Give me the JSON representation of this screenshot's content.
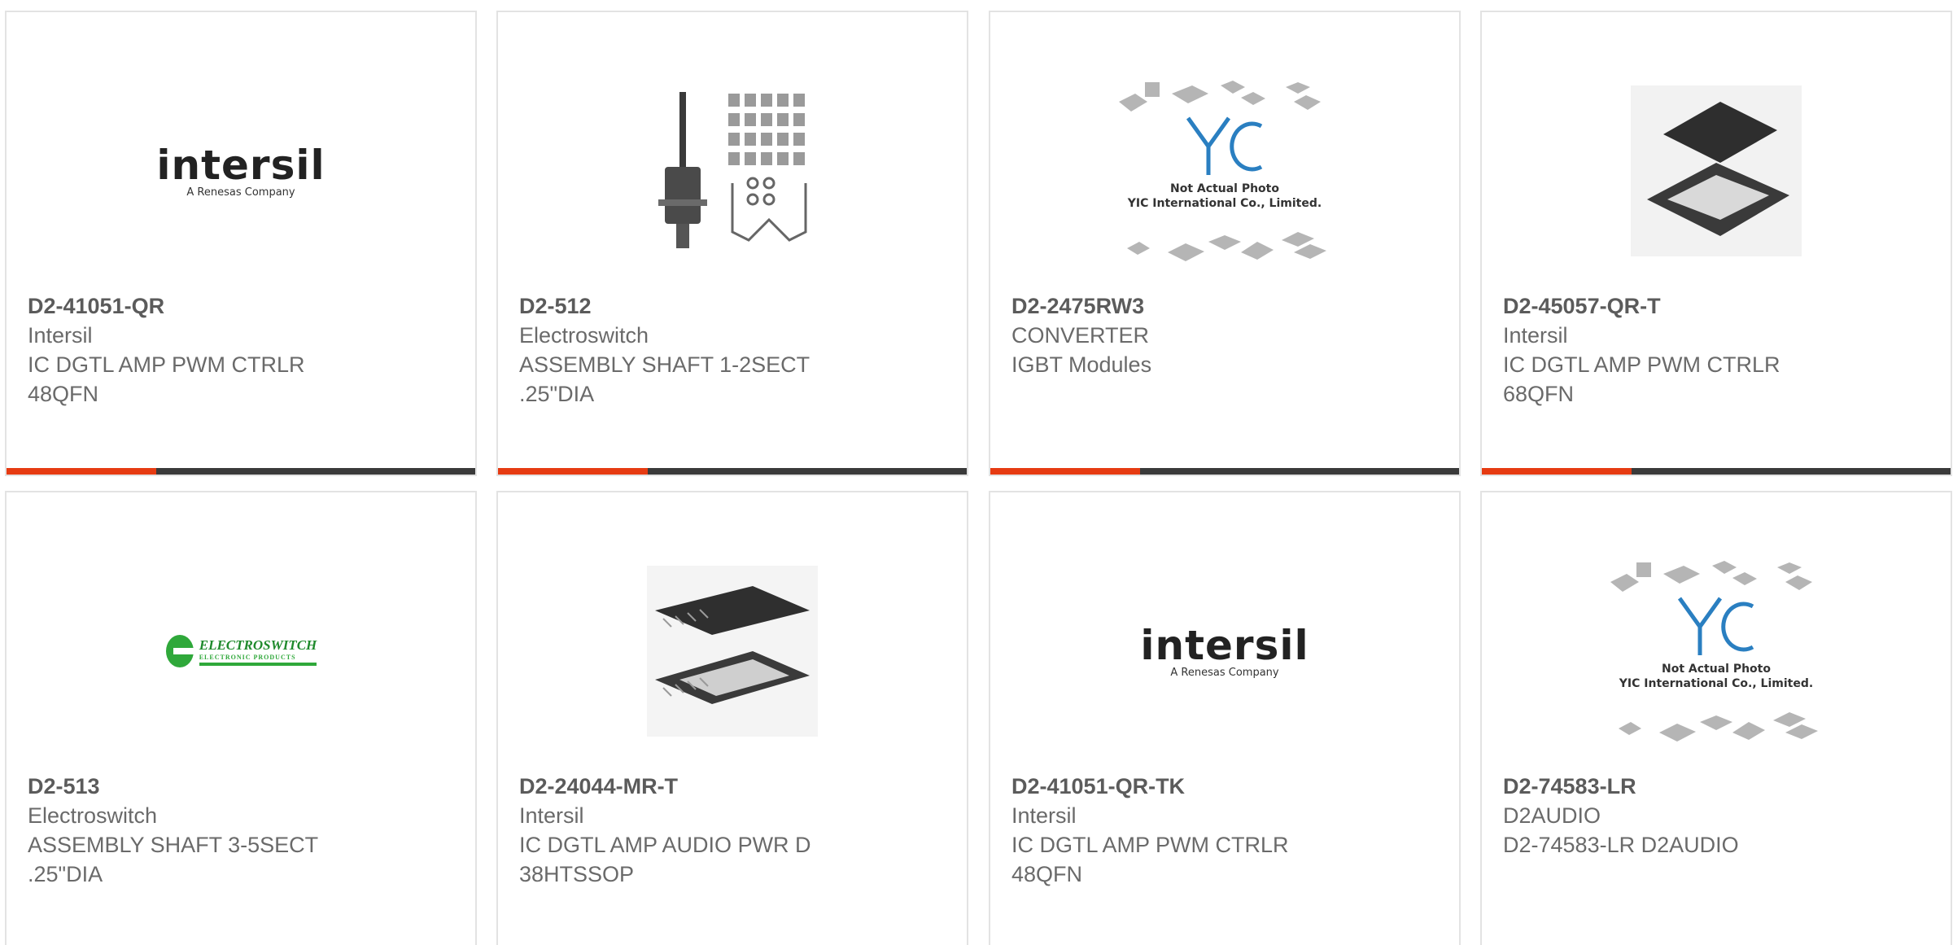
{
  "products": [
    {
      "part": "D2-41051-QR",
      "maker": "Intersil",
      "desc1": "IC DGTL AMP PWM CTRLR",
      "desc2": "48QFN",
      "image": "intersil-logo",
      "logo_word": "intersil",
      "logo_sub": "A Renesas Company"
    },
    {
      "part": "D2-512",
      "maker": "Electroswitch",
      "desc1": "ASSEMBLY SHAFT 1-2SECT",
      "desc2": ".25\"DIA",
      "image": "rotary-switch-kit"
    },
    {
      "part": "D2-2475RW3",
      "maker": "CONVERTER",
      "desc1": "IGBT Modules",
      "desc2": "",
      "image": "yic-placeholder",
      "yic_line1": "Not Actual Photo",
      "yic_line2": "YIC International Co., Limited."
    },
    {
      "part": "D2-45057-QR-T",
      "maker": "Intersil",
      "desc1": "IC DGTL AMP PWM CTRLR",
      "desc2": "68QFN",
      "image": "qfn-chip"
    },
    {
      "part": "D2-513",
      "maker": "Electroswitch",
      "desc1": "ASSEMBLY SHAFT 3-5SECT",
      "desc2": ".25\"DIA",
      "image": "electroswitch-logo",
      "logo_word": "ELECTROSWITCH",
      "logo_sub": "ELECTRONIC PRODUCTS"
    },
    {
      "part": "D2-24044-MR-T",
      "maker": "Intersil",
      "desc1": "IC DGTL AMP AUDIO PWR D",
      "desc2": "38HTSSOP",
      "image": "htssop-chip"
    },
    {
      "part": "D2-41051-QR-TK",
      "maker": "Intersil",
      "desc1": "IC DGTL AMP PWM CTRLR",
      "desc2": "48QFN",
      "image": "intersil-logo",
      "logo_word": "intersil",
      "logo_sub": "A Renesas Company"
    },
    {
      "part": "D2-74583-LR",
      "maker": "D2AUDIO",
      "desc1": "D2-74583-LR D2AUDIO",
      "desc2": "",
      "image": "yic-placeholder",
      "yic_line1": "Not Actual Photo",
      "yic_line2": "YIC International Co., Limited."
    }
  ],
  "colors": {
    "accent": "#e63b12",
    "bar": "#3a3a3a",
    "border": "#e3e3e3",
    "part_text": "#5b5b5b",
    "body_text": "#6a6a6a",
    "yic_blue": "#2a7fc1",
    "electroswitch_green": "#2fa83a"
  }
}
